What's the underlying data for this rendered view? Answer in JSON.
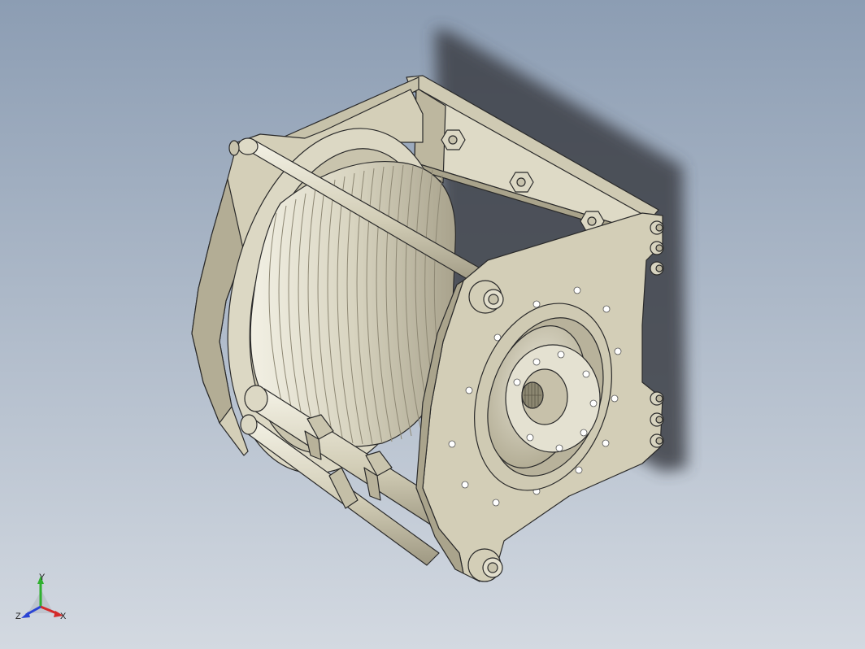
{
  "viewport": {
    "background_top": "#8c9db3",
    "background_bottom": "#d3d9e1",
    "model": "winch-drum-assembly"
  },
  "triad": {
    "x_label": "X",
    "y_label": "Y",
    "z_label": "Z",
    "x_color": "#d42a2a",
    "y_color": "#2fb02f",
    "z_color": "#2a44d4"
  },
  "colors": {
    "body": "#d6d1bb",
    "body_dark": "#aaa48c",
    "shadow": "#3c3f47",
    "edge": "#2a2a2a"
  }
}
